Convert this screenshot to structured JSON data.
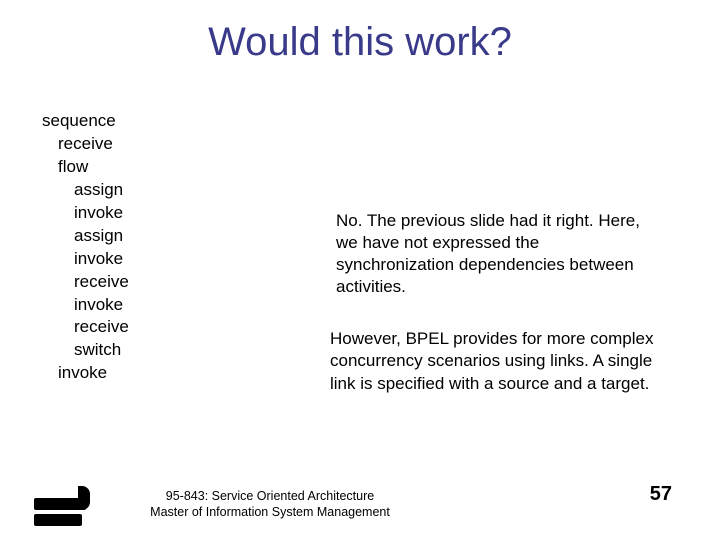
{
  "title": "Would this work?",
  "code": {
    "l0": "sequence",
    "l1": "receive",
    "l2": "flow",
    "l3": "assign",
    "l4": "invoke",
    "l5": "assign",
    "l6": "invoke",
    "l7": "receive",
    "l8": "invoke",
    "l9": "receive",
    "l10": "switch",
    "l11": "invoke"
  },
  "para1": "No. The previous slide had it right. Here, we have not expressed the synchronization dependencies between activities.",
  "para2": "However, BPEL provides for more complex concurrency scenarios using links. A single link is specified with a source and a target.",
  "footer": {
    "course_line1": "95-843: Service Oriented Architecture",
    "course_line2": "Master of Information System Management"
  },
  "page": "57"
}
